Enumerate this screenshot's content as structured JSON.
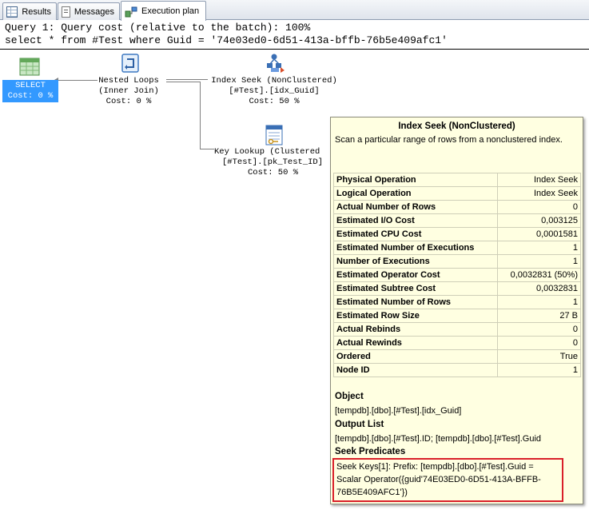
{
  "tabs": [
    {
      "label": "Results",
      "icon": "results-grid-icon"
    },
    {
      "label": "Messages",
      "icon": "messages-icon"
    },
    {
      "label": "Execution plan",
      "icon": "execution-plan-icon",
      "active": true
    }
  ],
  "query": {
    "line1": "Query 1: Query cost (relative to the batch): 100%",
    "line2": "select * from #Test where Guid = '74e03ed0-6d51-413a-bffb-76b5e409afc1'"
  },
  "plan": {
    "select": {
      "label": "SELECT",
      "cost": "Cost: 0 %",
      "icon": "select-icon"
    },
    "nested_loops": {
      "line1": "Nested Loops",
      "line2": "(Inner Join)",
      "cost": "Cost: 0 %",
      "icon": "nested-loops-icon"
    },
    "index_seek": {
      "line1": "Index Seek (NonClustered)",
      "line2": "[#Test].[idx_Guid]",
      "cost": "Cost: 50 %",
      "icon": "index-seek-icon"
    },
    "key_lookup": {
      "line1": "Key Lookup (Clustered",
      "line2": "[#Test].[pk_Test_ID]",
      "cost": "Cost: 50 %",
      "icon": "key-lookup-icon"
    }
  },
  "tooltip": {
    "title": "Index Seek (NonClustered)",
    "description": "Scan a particular range of rows from a nonclustered index.",
    "properties": [
      {
        "name": "Physical Operation",
        "value": "Index Seek"
      },
      {
        "name": "Logical Operation",
        "value": "Index Seek"
      },
      {
        "name": "Actual Number of Rows",
        "value": "0"
      },
      {
        "name": "Estimated I/O Cost",
        "value": "0,003125"
      },
      {
        "name": "Estimated CPU Cost",
        "value": "0,0001581"
      },
      {
        "name": "Estimated Number of Executions",
        "value": "1"
      },
      {
        "name": "Number of Executions",
        "value": "1"
      },
      {
        "name": "Estimated Operator Cost",
        "value": "0,0032831 (50%)"
      },
      {
        "name": "Estimated Subtree Cost",
        "value": "0,0032831"
      },
      {
        "name": "Estimated Number of Rows",
        "value": "1"
      },
      {
        "name": "Estimated Row Size",
        "value": "27 B"
      },
      {
        "name": "Actual Rebinds",
        "value": "0"
      },
      {
        "name": "Actual Rewinds",
        "value": "0"
      },
      {
        "name": "Ordered",
        "value": "True"
      },
      {
        "name": "Node ID",
        "value": "1"
      }
    ],
    "object_label": "Object",
    "object_value": "[tempdb].[dbo].[#Test].[idx_Guid]",
    "output_label": "Output List",
    "output_value": "[tempdb].[dbo].[#Test].ID; [tempdb].[dbo].[#Test].Guid",
    "seek_label": "Seek Predicates",
    "seek_line1": "Seek Keys[1]: Prefix: [tempdb].[dbo].[#Test].Guid =",
    "seek_line2": "Scalar Operator({guid'74E03ED0-6D51-413A-BFFB-",
    "seek_line3": "76B5E409AFC1'})",
    "highlight_color": "#d9202a"
  }
}
